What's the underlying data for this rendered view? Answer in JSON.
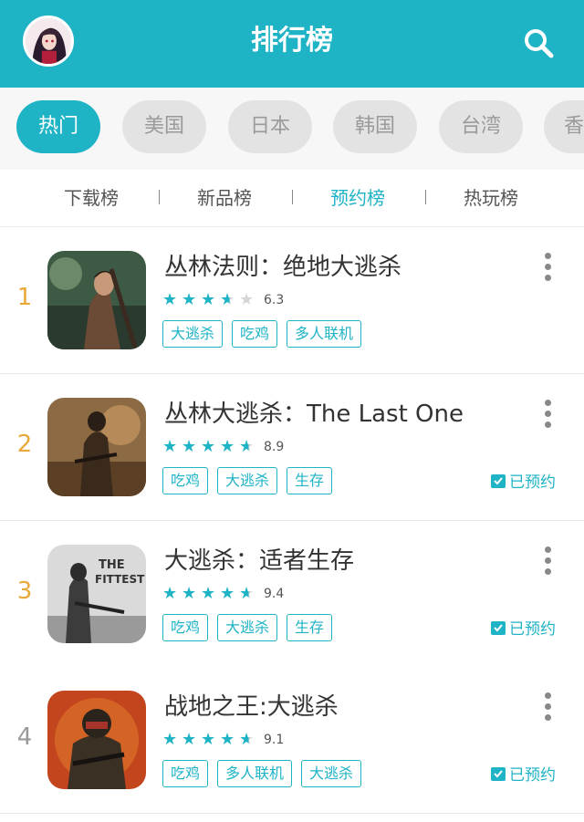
{
  "header": {
    "title": "排行榜",
    "icons": [
      "avatar",
      "search-icon"
    ]
  },
  "regions": [
    {
      "label": "热门",
      "active": true
    },
    {
      "label": "美国",
      "active": false
    },
    {
      "label": "日本",
      "active": false
    },
    {
      "label": "韩国",
      "active": false
    },
    {
      "label": "台湾",
      "active": false
    },
    {
      "label": "香",
      "active": false
    }
  ],
  "tabs": [
    {
      "label": "下载榜",
      "active": false
    },
    {
      "label": "新品榜",
      "active": false
    },
    {
      "label": "预约榜",
      "active": true
    },
    {
      "label": "热玩榜",
      "active": false
    }
  ],
  "games": [
    {
      "rank": "1",
      "name": "丛林法则：绝地大逃杀",
      "rating": 6.3,
      "score": "6.3",
      "stars": 3,
      "tags": [
        "大逃杀",
        "吃鸡",
        "多人联机"
      ],
      "reserved": ""
    },
    {
      "rank": "2",
      "name": "丛林大逃杀：The Last One",
      "rating": 8.9,
      "score": "8.9",
      "stars": 4.5,
      "tags": [
        "吃鸡",
        "大逃杀",
        "生存"
      ],
      "reserved": "已预约"
    },
    {
      "rank": "3",
      "name": "大逃杀：适者生存",
      "rating": 9.4,
      "score": "9.4",
      "stars": 4.5,
      "tags": [
        "吃鸡",
        "大逃杀",
        "生存"
      ],
      "reserved": "已预约"
    },
    {
      "rank": "4",
      "name": "战地之王:大逃杀",
      "rating": 9.1,
      "score": "9.1",
      "stars": 4.5,
      "tags": [
        "吃鸡",
        "多人联机",
        "大逃杀"
      ],
      "reserved": "已预约"
    }
  ],
  "colors": {
    "accent": "#1fb3c6",
    "rank_gold": "#e8a93a",
    "rank_gray": "#999999"
  }
}
